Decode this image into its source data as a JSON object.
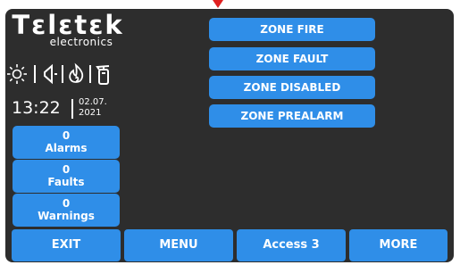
{
  "brand": {
    "name": "Τεlεtεk",
    "sub": "electronics"
  },
  "status_icons": [
    "sun-icon",
    "speaker-icon",
    "flame-icon",
    "extinguisher-icon"
  ],
  "clock": {
    "time": "13:22",
    "date_line1": "02.07.",
    "date_line2": "2021"
  },
  "counters": [
    {
      "count": "0",
      "label": "Alarms"
    },
    {
      "count": "0",
      "label": "Faults"
    },
    {
      "count": "0",
      "label": "Warnings"
    }
  ],
  "zone_buttons": [
    "ZONE FIRE",
    "ZONE FAULT",
    "ZONE DISABLED",
    "ZONE PREALARM"
  ],
  "bottom_bar": [
    "EXIT",
    "MENU",
    "Access 3",
    "MORE"
  ],
  "colors": {
    "accent": "#2f8ee8",
    "screen": "#2d2d2d",
    "marker": "#e02020"
  }
}
